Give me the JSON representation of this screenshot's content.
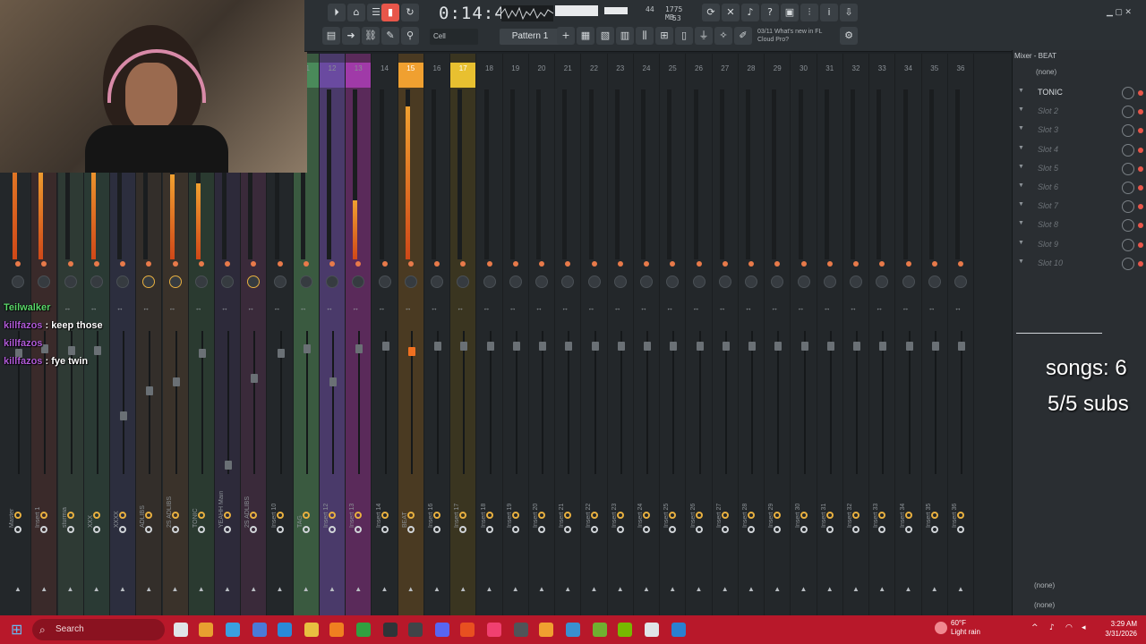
{
  "toolbar": {
    "time": "0:14:47",
    "time_sub": "M:S:CS",
    "cpu_value": "44",
    "ram_value": "1775 MB",
    "voices": "53",
    "snap": "Cell",
    "pattern": "Pattern 1",
    "news_date": "03/11",
    "news_text": "What's new in FL Cloud Pro?"
  },
  "mixer": {
    "header_numbers": [
      "",
      "",
      "",
      "",
      "",
      "",
      "",
      "",
      "",
      "",
      "",
      "",
      "11",
      "12",
      "13",
      "14",
      "15",
      "16",
      "17",
      "18",
      "19",
      "20",
      "21",
      "22",
      "23",
      "24",
      "25",
      "26",
      "27",
      "28",
      "29",
      "30",
      "31",
      "32",
      "33",
      "34",
      "35",
      "36"
    ],
    "strip_names": [
      "Master",
      "Insert 1",
      "sturmia",
      "XXX",
      "XXXX",
      "ADLIBS",
      "2S ADLIBS",
      "TONIC",
      "YEAHH Main",
      "2S ADLIBS",
      "Insert 10",
      "TAG",
      "Insert 12",
      "Insert 13",
      "Insert 14",
      "BEAT",
      "Insert 16",
      "Insert 17",
      "Insert 18",
      "Insert 19",
      "Insert 20",
      "Insert 21",
      "Insert 22",
      "Insert 23",
      "Insert 24",
      "Insert 25",
      "Insert 26",
      "Insert 27",
      "Insert 28",
      "Insert 29",
      "Insert 30",
      "Insert 31",
      "Insert 32",
      "Insert 33",
      "Insert 34",
      "Insert 35",
      "Insert 36"
    ]
  },
  "right_panel": {
    "title": "Mixer - BEAT",
    "preset": "(none)",
    "slots": [
      "TONIC",
      "Slot 2",
      "Slot 3",
      "Slot 4",
      "Slot 5",
      "Slot 6",
      "Slot 7",
      "Slot 8",
      "Slot 9",
      "Slot 10"
    ],
    "out_1": "(none)",
    "out_2": "(none)"
  },
  "chat": [
    {
      "user": "Teilwalker",
      "message": "",
      "color": "green"
    },
    {
      "user": "killfazos",
      "message": "keep those",
      "color": "purple"
    },
    {
      "user": "killfazos",
      "message": "",
      "color": "purple"
    },
    {
      "user": "killfazos",
      "message": "fye twin",
      "color": "purple"
    }
  ],
  "overlay": {
    "songs": "songs: 6",
    "subs": "5/5 subs"
  },
  "taskbar": {
    "search": "Search",
    "weather_temp": "60°F",
    "weather_desc": "Light rain",
    "time": "3:29 AM",
    "date": "3/31/2026"
  },
  "colors": {
    "accent_orange": "#f0a030",
    "taskbar": "#b8182a",
    "strip_green": "#4a8a5a",
    "strip_purple": "#6a4aa0",
    "strip_magenta": "#a03aa8",
    "strip_yellow": "#e8b830"
  }
}
